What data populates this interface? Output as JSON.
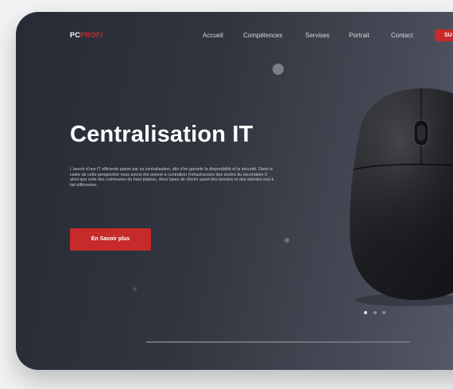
{
  "brand": {
    "logo_pc": "PC",
    "logo_profi": "PROFI",
    "accent": "#c62a2a"
  },
  "nav": {
    "items": [
      "Accueil",
      "Compétences",
      "Servises",
      "Portrait",
      "Contact"
    ],
    "cta_label": "SU"
  },
  "hero": {
    "title": "Centralisation IT",
    "text": "L'avenir d'une IT efficiente passe par sa centralisation, afin d'en garantir la disponibilité et la sécurité. Dans le cadre de cette perspective nous avons été amené à centraliser l'infrastructure des écoles du secondaire II ainsi que celle des communes du haut plateau, deux types de clients ayant des besoins et des attentes tout à fait différentes.",
    "button_label": "En Savoir plus"
  },
  "slider": {
    "active_index": 0,
    "count": 3
  },
  "icons": {
    "hero_image": "computer-mouse-icon"
  }
}
